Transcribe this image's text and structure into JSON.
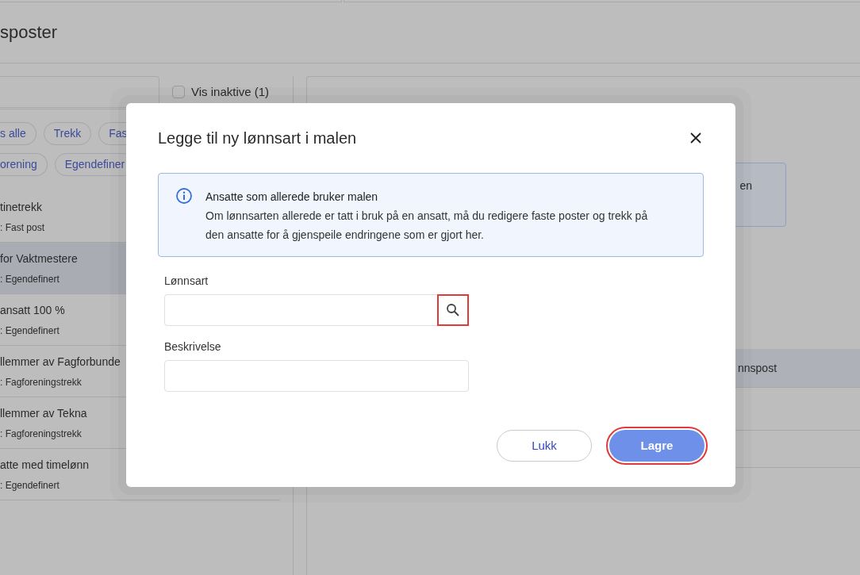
{
  "page": {
    "title": "sposter"
  },
  "filter": {
    "checkbox": {
      "label": "Vis inaktive (1)",
      "checked": false
    },
    "chips": [
      [
        "s alle",
        "Trekk",
        "Fas"
      ],
      [
        "orening",
        "Egendefiner"
      ]
    ]
  },
  "list": [
    {
      "name": "tinetrekk",
      "type": ": Fast post",
      "selected": false
    },
    {
      "name": "for Vaktmestere",
      "type": ": Egendefinert",
      "selected": true
    },
    {
      "name": " ansatt 100 %",
      "type": ": Egendefinert",
      "selected": false
    },
    {
      "name": "llemmer av Fagforbunde",
      "type": ": Fagforeningstrekk",
      "selected": false
    },
    {
      "name": "llemmer av Tekna",
      "type": ": Fagforeningstrekk",
      "selected": false
    },
    {
      "name": "atte med timelønn",
      "type": ": Egendefinert",
      "selected": false
    }
  ],
  "detail": {
    "box_text": "en",
    "row_text": "nnspost"
  },
  "dialog": {
    "title": "Legge til ny lønnsart i malen",
    "info": {
      "heading": "Ansatte som allerede bruker malen",
      "body": "Om lønnsarten allerede er tatt i bruk på en ansatt, må du redigere faste poster og trekk på den ansatte for å gjenspeile endringene som er gjort her."
    },
    "fields": [
      {
        "label": "Lønnsart",
        "kind": "search",
        "highlighted": true
      },
      {
        "label": "Beskrivelse",
        "kind": "text",
        "highlighted": false
      }
    ],
    "buttons": [
      {
        "label": "Lukk",
        "kind": "secondary",
        "highlighted": false
      },
      {
        "label": "Lagre",
        "kind": "primary",
        "highlighted": true
      }
    ]
  }
}
